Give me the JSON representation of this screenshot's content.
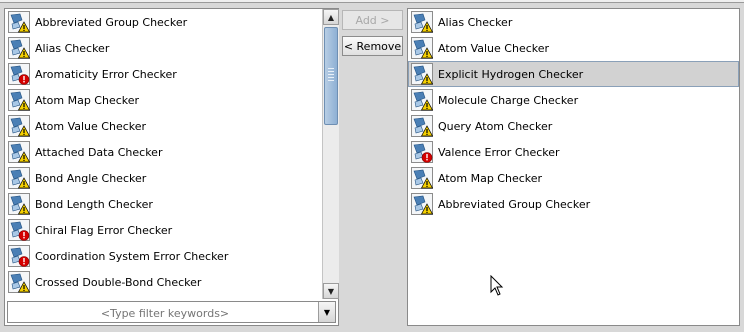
{
  "left_list": {
    "items": [
      {
        "label": "Abbreviated Group Checker",
        "badge": "warning"
      },
      {
        "label": "Alias Checker",
        "badge": "warning"
      },
      {
        "label": "Aromaticity Error Checker",
        "badge": "error"
      },
      {
        "label": "Atom Map Checker",
        "badge": "warning"
      },
      {
        "label": "Atom Value Checker",
        "badge": "warning"
      },
      {
        "label": "Attached Data Checker",
        "badge": "warning"
      },
      {
        "label": "Bond Angle Checker",
        "badge": "warning"
      },
      {
        "label": "Bond Length Checker",
        "badge": "warning"
      },
      {
        "label": "Chiral Flag Error Checker",
        "badge": "error"
      },
      {
        "label": "Coordination System Error Checker",
        "badge": "error"
      },
      {
        "label": "Crossed Double-Bond Checker",
        "badge": "warning"
      }
    ],
    "scroll_position": 0.0
  },
  "filter": {
    "placeholder": "<Type filter keywords>",
    "value": ""
  },
  "buttons": {
    "add_label": "Add >",
    "remove_label": "< Remove"
  },
  "right_list": {
    "items": [
      {
        "label": "Alias Checker",
        "badge": "warning",
        "selected": false
      },
      {
        "label": "Atom Value Checker",
        "badge": "warning",
        "selected": false
      },
      {
        "label": "Explicit Hydrogen Checker",
        "badge": "warning",
        "selected": true
      },
      {
        "label": "Molecule Charge Checker",
        "badge": "warning",
        "selected": false
      },
      {
        "label": "Query Atom Checker",
        "badge": "warning",
        "selected": false
      },
      {
        "label": "Valence Error Checker",
        "badge": "error",
        "selected": false
      },
      {
        "label": "Atom Map Checker",
        "badge": "warning",
        "selected": false
      },
      {
        "label": "Abbreviated Group Checker",
        "badge": "warning",
        "selected": false
      }
    ]
  },
  "icons": {
    "checker": "molecule-checker-icon",
    "warning": "warning-triangle-icon",
    "error": "error-circle-icon",
    "scroll_up": "chevron-up-icon",
    "scroll_down": "chevron-down-icon",
    "dropdown": "chevron-down-icon"
  },
  "colors": {
    "warning": "#f5d000",
    "error": "#d40000",
    "selection": "#d2d2d2",
    "scroll_thumb": "#8eb0d4"
  }
}
